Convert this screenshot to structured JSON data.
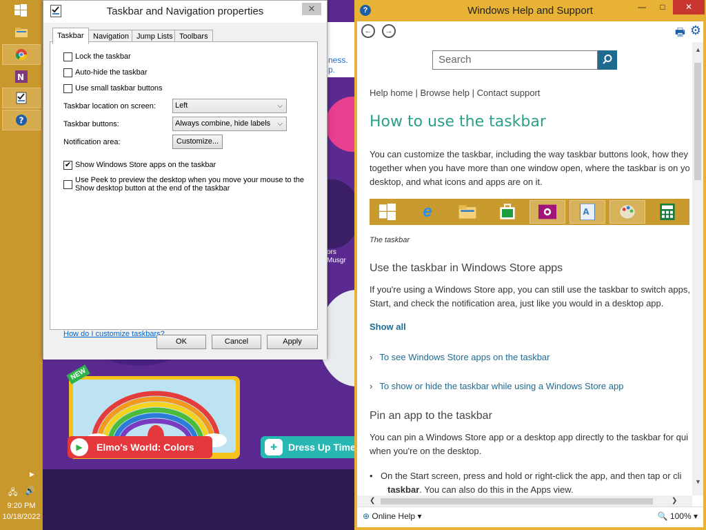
{
  "taskbar": {
    "clock_time": "9:20 PM",
    "clock_date": "10/18/2022",
    "buttons": [
      "start-button",
      "file-explorer",
      "chrome",
      "onenote",
      "taskbar-properties",
      "help-and-support"
    ]
  },
  "background_page": {
    "link_text_1": "ness.",
    "link_text_2": "p.",
    "banner_line_1": "ors",
    "banner_line_2": "Musgr",
    "card1_badge": "NEW",
    "card1_label": "Elmo's World: Colors",
    "card2_label": "Dress Up Time"
  },
  "props": {
    "title": "Taskbar and Navigation properties",
    "close": "✕",
    "tabs": [
      "Taskbar",
      "Navigation",
      "Jump Lists",
      "Toolbars"
    ],
    "options": {
      "lock": {
        "label": "Lock the taskbar",
        "checked": false
      },
      "autohide": {
        "label": "Auto-hide the taskbar",
        "checked": false
      },
      "small": {
        "label": "Use small taskbar buttons",
        "checked": false
      },
      "store": {
        "label": "Show Windows Store apps on the taskbar",
        "checked": true
      },
      "peek": {
        "label": "Use Peek to preview the desktop when you move your mouse to the Show desktop button at the end of the taskbar",
        "checked": false
      },
      "peek_line1": "Use Peek to preview the desktop when you move your mouse to the",
      "peek_line2": "Show desktop button at the end of the taskbar"
    },
    "location_label": "Taskbar location on screen:",
    "location_value": "Left",
    "buttons_label": "Taskbar buttons:",
    "buttons_value": "Always combine, hide labels",
    "notification_label": "Notification area:",
    "customize": "Customize...",
    "help_link": "How do I customize taskbars?",
    "ok": "OK",
    "cancel": "Cancel",
    "apply": "Apply"
  },
  "help": {
    "title": "Windows Help and Support",
    "minimize": "—",
    "maximize": "□",
    "close": "✕",
    "search_placeholder": "Search",
    "crumbs": "Help home | Browse help | Contact support",
    "heading": "How to use the taskbar",
    "intro": "You can customize the taskbar, including the way taskbar buttons look, how they group together when you have more than one window open, where the taskbar is on your desktop, and what icons and apps are on it.",
    "intro_lines": [
      "You can customize the taskbar, including the way taskbar buttons look, how they",
      "together when you have more than one window open, where the taskbar is on yo",
      "desktop, and what icons and apps are on it."
    ],
    "caption": "The taskbar",
    "h2_store": "Use the taskbar in Windows Store apps",
    "store_lines": [
      "If you're using a Windows Store app, you can still use the taskbar to switch apps,",
      "Start, and check the notification area, just like you would in a desktop app."
    ],
    "show_all": "Show all",
    "expander1": "To see Windows Store apps on the taskbar",
    "expander2": "To show or hide the taskbar while using a Windows Store app",
    "h2_pin": "Pin an app to the taskbar",
    "pin_lines": [
      "You can pin a Windows Store app or a desktop app directly to the taskbar for qui",
      "when you're on the desktop."
    ],
    "bullet_line1": "On the Start screen, press and hold or right-click the app, and then tap or cli",
    "bullet_bold": "taskbar",
    "bullet_rest": ". You can also do this in the Apps view.",
    "status_left": "Online Help",
    "zoom": "100%"
  },
  "colors": {
    "taskbar": "#c9982c",
    "help_frame": "#e7b235",
    "heading": "#2aa08a",
    "link": "#1f6a8f",
    "purple_bg": "#5a2a91"
  }
}
